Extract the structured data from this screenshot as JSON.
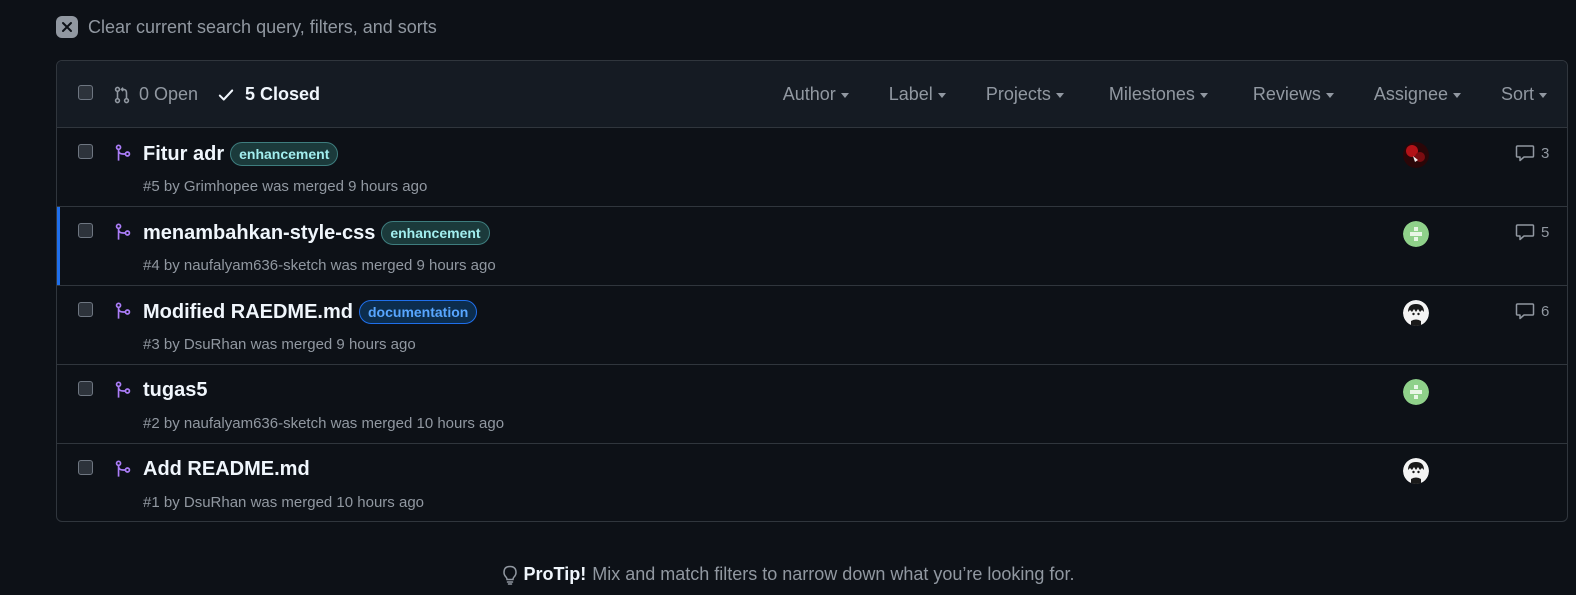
{
  "clear_filters": {
    "label": "Clear current search query, filters, and sorts"
  },
  "header": {
    "open_label": "0 Open",
    "closed_label": "5 Closed",
    "filters": [
      "Author",
      "Label",
      "Projects",
      "Milestones",
      "Reviews",
      "Assignee",
      "Sort"
    ]
  },
  "pull_requests": [
    {
      "title": "Fitur adr",
      "label": "enhancement",
      "meta": "#5 by Grimhopee was merged 9 hours ago",
      "comments": "3",
      "avatar": "red-dark-avatar"
    },
    {
      "title": "menambahkan-style-css",
      "label": "enhancement",
      "meta": "#4 by naufalyam636-sketch was merged 9 hours ago",
      "comments": "5",
      "avatar": "green-identicon-avatar"
    },
    {
      "title": "Modified RAEDME.md",
      "label": "documentation",
      "meta": "#3 by DsuRhan was merged 9 hours ago",
      "comments": "6",
      "avatar": "anime-avatar"
    },
    {
      "title": "tugas5",
      "label": "",
      "meta": "#2 by naufalyam636-sketch was merged 10 hours ago",
      "comments": "",
      "avatar": "green-identicon-avatar"
    },
    {
      "title": "Add README.md",
      "label": "",
      "meta": "#1 by DsuRhan was merged 10 hours ago",
      "comments": "",
      "avatar": "anime-avatar"
    }
  ],
  "protip": {
    "bold": "ProTip!",
    "text": "Mix and match filters to narrow down what you’re looking for."
  },
  "colors": {
    "background": "#0d1117",
    "merged_purple": "#ab7df8",
    "accent_blue": "#1f6feb",
    "border": "#30363d"
  }
}
